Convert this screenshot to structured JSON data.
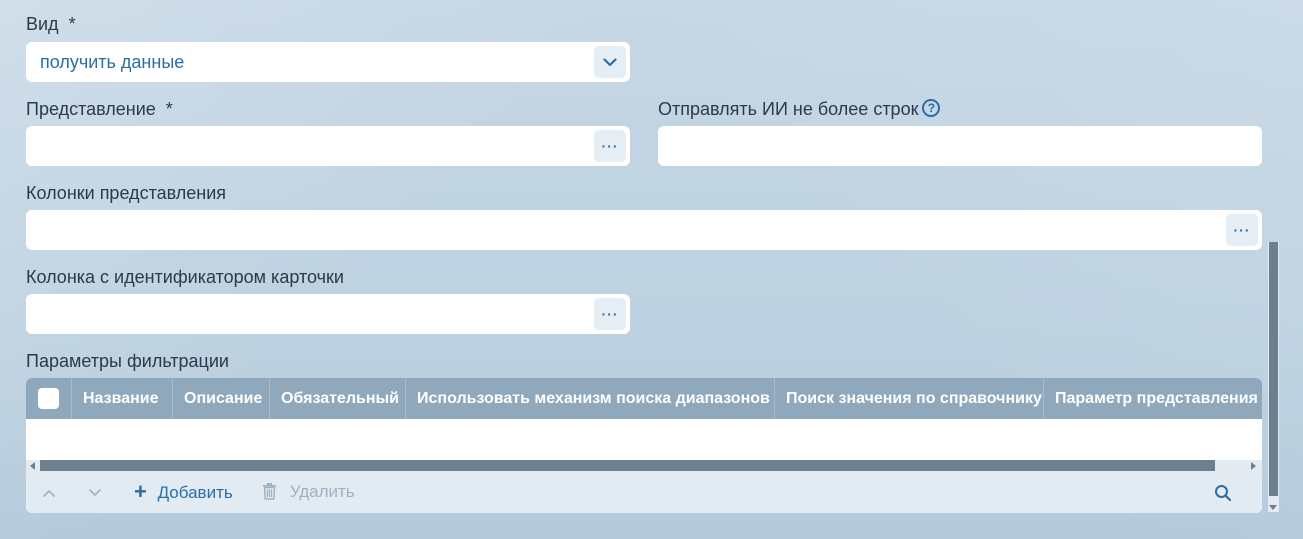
{
  "form": {
    "vid": {
      "label": "Вид",
      "required_mark": "*",
      "value": "получить данные"
    },
    "predstavlenie": {
      "label": "Представление",
      "required_mark": "*",
      "button_label": "···"
    },
    "max_rows": {
      "label": "Отправлять ИИ не более строк",
      "help_icon": "?"
    },
    "columns": {
      "label": "Колонки представления",
      "button_label": "···"
    },
    "id_column": {
      "label": "Колонка с идентификатором карточки",
      "button_label": "···"
    }
  },
  "filters": {
    "label": "Параметры фильтрации",
    "columns": [
      "Название",
      "Описание",
      "Обязательный",
      "Использовать механизм поиска диапазонов",
      "Поиск значения по справочнику",
      "Параметр представления"
    ],
    "toolbar": {
      "move_up": "⌃",
      "move_down": "⌄",
      "add_icon": "+",
      "add_label": "Добавить",
      "delete_icon": "🗑",
      "delete_label": "Удалить",
      "search_icon": "⌕"
    }
  },
  "colors": {
    "accent": "#2a6ea5",
    "header_bg": "#8fa8bc",
    "disabled": "#9fb2c2"
  }
}
